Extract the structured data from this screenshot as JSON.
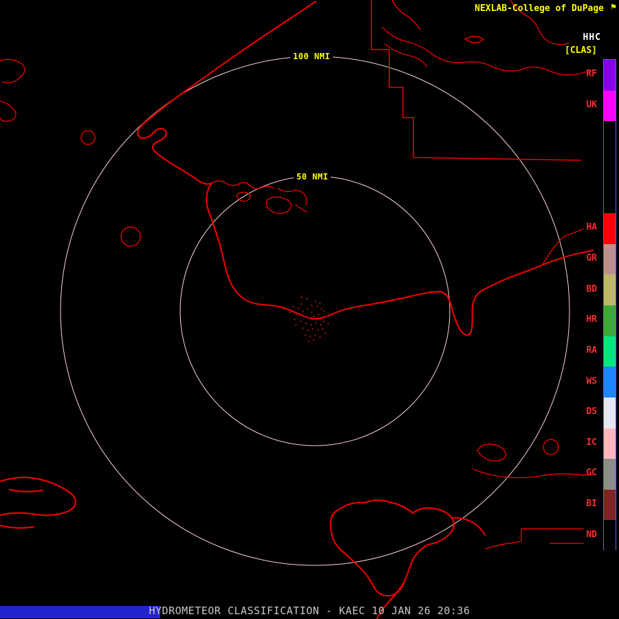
{
  "header": {
    "title": "NEXLAB-College of DuPage",
    "logo_glyph": "⚑",
    "product_code": "HHC",
    "product_tag": "[CLAS]"
  },
  "rings": {
    "outer_label": "100 NMI",
    "inner_label": "50 NMI"
  },
  "legend": {
    "segments": [
      {
        "label": "RF",
        "color": "#8a00e8"
      },
      {
        "label": "UK",
        "color": "#ff00ff"
      },
      {
        "label": "",
        "color": "#000000"
      },
      {
        "label": "",
        "color": "#000000"
      },
      {
        "label": "",
        "color": "#000000"
      },
      {
        "label": "HA",
        "color": "#ff0000"
      },
      {
        "label": "GR",
        "color": "#bc8f8f"
      },
      {
        "label": "BD",
        "color": "#bdb76b"
      },
      {
        "label": "HR",
        "color": "#3fa73f"
      },
      {
        "label": "RA",
        "color": "#00e87d"
      },
      {
        "label": "WS",
        "color": "#1e86ff"
      },
      {
        "label": "DS",
        "color": "#e6e6fa"
      },
      {
        "label": "IC",
        "color": "#ffb6c1"
      },
      {
        "label": "GC",
        "color": "#8c8c8c"
      },
      {
        "label": "BI",
        "color": "#7e2424"
      },
      {
        "label": "ND",
        "color": "#000000"
      }
    ]
  },
  "status_bar": {
    "text": "HYDROMETEOR CLASSIFICATION - KAEC 10 JAN 26 20:36"
  },
  "colors": {
    "map_outline": "#e60000",
    "range_ring": "#ffd6d6",
    "label_yellow": "#ffff00",
    "status_text": "#c8c8c8",
    "blue_bar": "#2424cc",
    "legend_border": "#5c5cff",
    "legend_label": "#f03030",
    "echo": "#6e1212"
  },
  "radar_echoes": [
    [
      433,
      447
    ],
    [
      439,
      451
    ],
    [
      446,
      448
    ],
    [
      452,
      453
    ],
    [
      441,
      459
    ],
    [
      448,
      461
    ],
    [
      455,
      459
    ],
    [
      462,
      456
    ],
    [
      436,
      466
    ],
    [
      444,
      469
    ],
    [
      451,
      471
    ],
    [
      458,
      468
    ],
    [
      465,
      471
    ],
    [
      470,
      466
    ],
    [
      439,
      476
    ],
    [
      447,
      479
    ],
    [
      453,
      477
    ],
    [
      461,
      479
    ],
    [
      468,
      477
    ],
    [
      443,
      486
    ],
    [
      450,
      488
    ],
    [
      457,
      486
    ],
    [
      464,
      489
    ],
    [
      430,
      456
    ],
    [
      427,
      463
    ],
    [
      470,
      451
    ],
    [
      474,
      459
    ],
    [
      437,
      441
    ],
    [
      452,
      443
    ],
    [
      460,
      444
    ],
    [
      466,
      448
    ],
    [
      455,
      493
    ],
    [
      448,
      495
    ],
    [
      472,
      483
    ],
    [
      429,
      471
    ],
    [
      421,
      453
    ],
    [
      425,
      445
    ],
    [
      476,
      469
    ],
    [
      445,
      433
    ],
    [
      437,
      431
    ],
    [
      458,
      437
    ],
    [
      464,
      440
    ]
  ]
}
